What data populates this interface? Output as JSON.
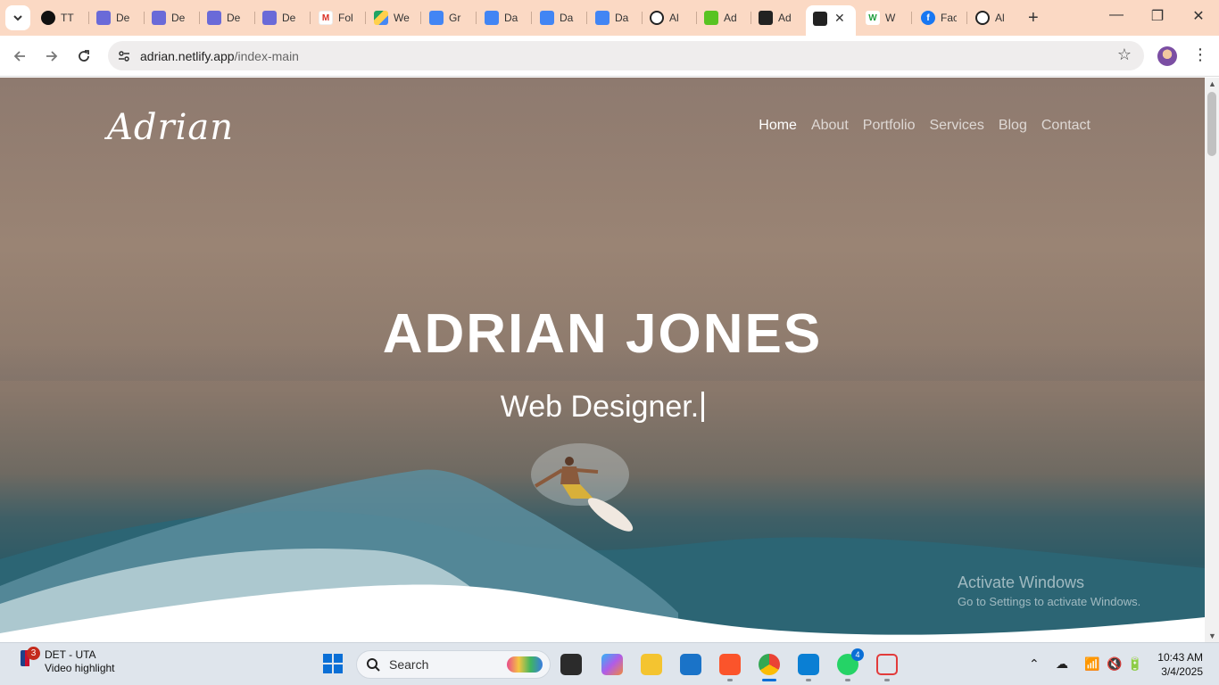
{
  "browser": {
    "tabs": [
      {
        "title": "TT",
        "icon": "github-icon"
      },
      {
        "title": "De",
        "icon": "devto-icon"
      },
      {
        "title": "De",
        "icon": "devto-icon"
      },
      {
        "title": "De",
        "icon": "devto-icon"
      },
      {
        "title": "De",
        "icon": "devto-icon"
      },
      {
        "title": "Fol",
        "icon": "gmail-icon"
      },
      {
        "title": "We",
        "icon": "google-drive-icon"
      },
      {
        "title": "Gr",
        "icon": "google-docs-icon"
      },
      {
        "title": "Da",
        "icon": "google-docs-icon"
      },
      {
        "title": "Da",
        "icon": "google-docs-icon"
      },
      {
        "title": "Da",
        "icon": "google-docs-icon"
      },
      {
        "title": "Al",
        "icon": "openai-icon"
      },
      {
        "title": "Ad",
        "icon": "green-app-icon"
      },
      {
        "title": "Ad",
        "icon": "dark-site-icon"
      },
      {
        "title": "W",
        "icon": "w-icon"
      },
      {
        "title": "Fac",
        "icon": "facebook-icon"
      },
      {
        "title": "Al",
        "icon": "openai-icon"
      }
    ],
    "url_host": "adrian.netlify.app",
    "url_path": "/index-main"
  },
  "site": {
    "logo": "Adrian",
    "nav": [
      "Home",
      "About",
      "Portfolio",
      "Services",
      "Blog",
      "Contact"
    ],
    "hero_title": "ADRIAN JONES",
    "hero_subtitle": "Web Designer."
  },
  "watermark": {
    "line1": "Activate Windows",
    "line2": "Go to Settings to activate Windows."
  },
  "taskbar": {
    "news_badge": "3",
    "news_title": "DET - UTA",
    "news_subtitle": "Video highlight",
    "search_label": "Search",
    "vscode_badge": "4",
    "time": "10:43 AM",
    "date": "3/4/2025"
  },
  "colors": {
    "tabstrip": "#fbd9c4",
    "accent": "#0a6fd6"
  }
}
